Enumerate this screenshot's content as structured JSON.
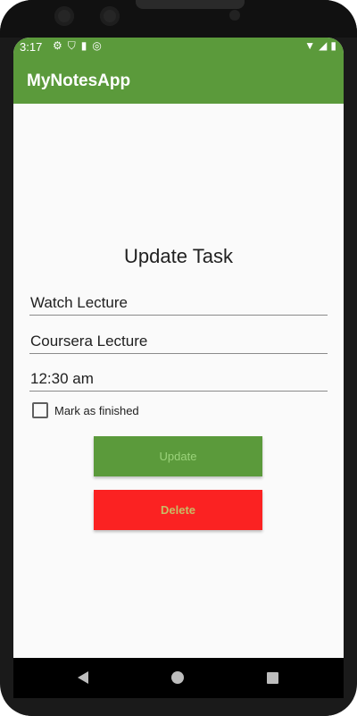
{
  "status_bar": {
    "time": "3:17",
    "left_icons": [
      "gear-icon",
      "shield-icon",
      "sd-card-icon",
      "sync-icon"
    ],
    "right_icons": [
      "wifi-icon",
      "signal-icon",
      "battery-icon"
    ]
  },
  "app_bar": {
    "title": "MyNotesApp"
  },
  "form": {
    "heading": "Update Task",
    "title_value": "Watch Lecture",
    "description_value": "Coursera Lecture",
    "time_value": "12:30 am",
    "finished_label": "Mark as finished",
    "finished_checked": false
  },
  "buttons": {
    "update_label": "Update",
    "delete_label": "Delete"
  },
  "colors": {
    "primary": "#5b9a3b",
    "delete": "#fb2222",
    "background": "#fafafa"
  },
  "nav_bar": {
    "icons": [
      "back-icon",
      "home-icon",
      "recents-icon"
    ]
  }
}
